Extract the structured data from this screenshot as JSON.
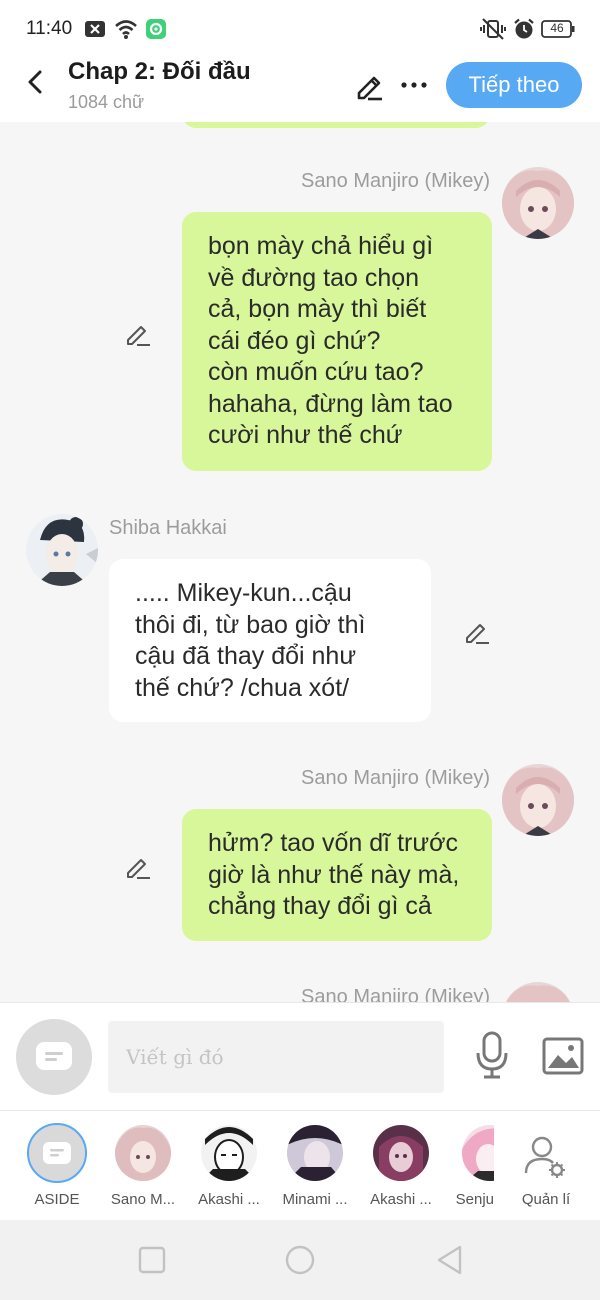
{
  "status_bar": {
    "time": "11:40",
    "battery": "46",
    "icons": [
      "close-notification-icon",
      "wifi-icon",
      "app-notification-icon",
      "vibrate-off-icon",
      "alarm-icon",
      "battery-icon"
    ]
  },
  "header": {
    "title": "Chap 2: Đối đầu",
    "subtitle": "1084 chữ",
    "next_label": "Tiếp theo",
    "icons": [
      "back-arrow-icon",
      "pencil-icon",
      "more-icon"
    ]
  },
  "colors": {
    "accent": "#58a9f4",
    "green_bubble": "#d8f79b",
    "white_bubble": "#ffffff",
    "background": "#f6f6f6"
  },
  "chat": {
    "messages": [
      {
        "sender": "Sano Manjiro (Mikey)",
        "side": "right",
        "text": "bọn mày chả hiểu gì\nvề đường tao chọn\ncả, bọn mày thì biết\ncái đéo gì chứ?\ncòn muốn cứu tao?\nhahaha, đừng làm tao\ncười như thế chứ"
      },
      {
        "sender": "Shiba Hakkai",
        "side": "left",
        "text": "..... Mikey-kun...cậu\nthôi đi, từ bao giờ thì\ncậu đã thay đổi như\nthế chứ? /chua xót/"
      },
      {
        "sender": "Sano Manjiro (Mikey)",
        "side": "right",
        "text": "hửm? tao vốn dĩ trước\ngiờ là như thế này mà,\nchẳng thay đổi gì cả"
      },
      {
        "sender": "Sano Manjiro (Mikey)",
        "side": "right",
        "text": ""
      }
    ]
  },
  "composer": {
    "placeholder": "Viết gì đó",
    "icons": [
      "aside-toggle-icon",
      "microphone-icon",
      "image-icon"
    ]
  },
  "characters": [
    {
      "label": "ASIDE",
      "icon": "chat-bubble-icon"
    },
    {
      "label": "Sano M..."
    },
    {
      "label": "Akashi ..."
    },
    {
      "label": "Minami ..."
    },
    {
      "label": "Akashi ..."
    },
    {
      "label": "Senju"
    },
    {
      "label": "Quản lí",
      "icon": "manage-user-icon"
    }
  ],
  "nav_bar": {
    "icons": [
      "recent-apps-icon",
      "home-icon",
      "back-icon"
    ]
  }
}
